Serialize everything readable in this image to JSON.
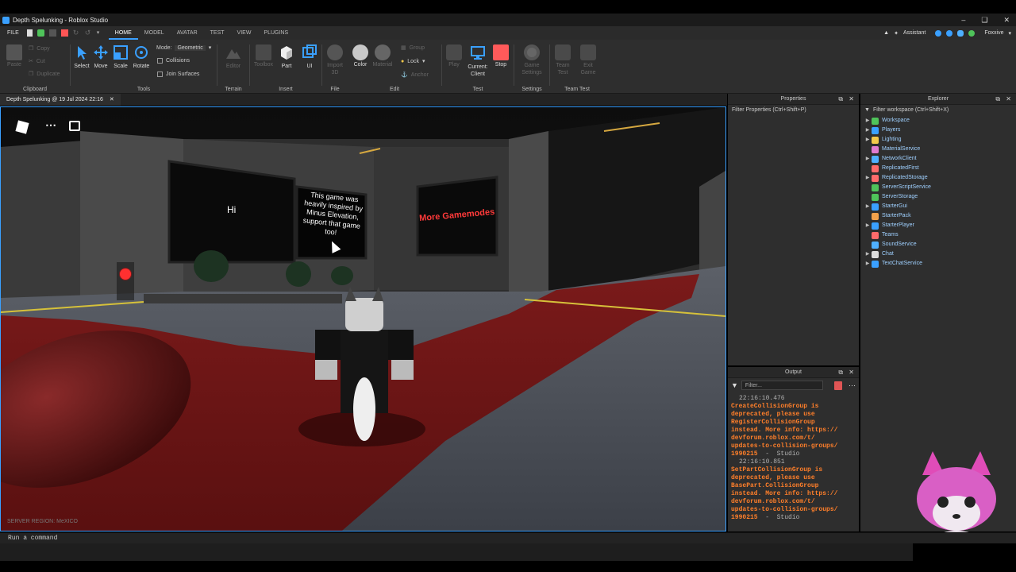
{
  "window": {
    "title": "Depth Spelunking - Roblox Studio"
  },
  "menu": {
    "file": "FILE",
    "tabs": [
      "HOME",
      "MODEL",
      "AVATAR",
      "TEST",
      "VIEW",
      "PLUGINS"
    ],
    "assistant": "Assistant",
    "user": "Foxxive"
  },
  "ribbon": {
    "clipboard": {
      "label": "Clipboard",
      "paste": "Paste",
      "copy": "Copy",
      "cut": "Cut",
      "duplicate": "Duplicate"
    },
    "tools": {
      "label": "Tools",
      "select": "Select",
      "move": "Move",
      "scale": "Scale",
      "rotate": "Rotate",
      "mode_label": "Mode:",
      "mode_value": "Geometric",
      "collisions": "Collisions",
      "join_surfaces": "Join Surfaces"
    },
    "terrain": {
      "label": "Terrain",
      "editor": "Editor"
    },
    "insert": {
      "label": "Insert",
      "toolbox": "Toolbox",
      "part": "Part",
      "ui": "UI"
    },
    "file": {
      "label": "File",
      "import3d": "Import 3D"
    },
    "edit": {
      "label": "Edit",
      "color": "Color",
      "material": "Material",
      "group": "Group",
      "lock": "Lock",
      "anchor": "Anchor"
    },
    "test": {
      "label": "Test",
      "play": "Play",
      "current_client": "Current: Client",
      "stop": "Stop"
    },
    "settings": {
      "label": "Settings",
      "game_settings": "Game Settings"
    },
    "team_test": {
      "label": "Team Test",
      "team_test": "Team Test",
      "exit_game": "Exit Game"
    }
  },
  "doc_tab": {
    "label": "Depth Spelunking @ 19 Jul 2024 22:16"
  },
  "viewport": {
    "sign_hi": "Hi",
    "sign_inspired_lines": [
      "This game was",
      "heavily inspired by",
      "Minus Elevation,",
      "support that game",
      "too!"
    ],
    "sign_gamemodes": "More Gamemodes",
    "server_region": "SERVER REGION: MeXICO"
  },
  "properties": {
    "title": "Properties",
    "filter_placeholder": "Filter Properties (Ctrl+Shift+P)"
  },
  "explorer": {
    "title": "Explorer",
    "filter_placeholder": "Filter workspace (Ctrl+Shift+X)",
    "items": [
      {
        "label": "Workspace",
        "expandable": true,
        "color": "#4fc35a"
      },
      {
        "label": "Players",
        "expandable": true,
        "color": "#3aa0ff"
      },
      {
        "label": "Lighting",
        "expandable": true,
        "color": "#f2c84b"
      },
      {
        "label": "MaterialService",
        "expandable": false,
        "color": "#e07bd0"
      },
      {
        "label": "NetworkClient",
        "expandable": true,
        "color": "#4fb0ff"
      },
      {
        "label": "ReplicatedFirst",
        "expandable": false,
        "color": "#ff6b6b"
      },
      {
        "label": "ReplicatedStorage",
        "expandable": true,
        "color": "#ff6b6b"
      },
      {
        "label": "ServerScriptService",
        "expandable": false,
        "color": "#4fc35a"
      },
      {
        "label": "ServerStorage",
        "expandable": false,
        "color": "#4fc35a"
      },
      {
        "label": "StarterGui",
        "expandable": true,
        "color": "#3aa0ff"
      },
      {
        "label": "StarterPack",
        "expandable": false,
        "color": "#f2a14b"
      },
      {
        "label": "StarterPlayer",
        "expandable": true,
        "color": "#3aa0ff"
      },
      {
        "label": "Teams",
        "expandable": false,
        "color": "#ff6b6b"
      },
      {
        "label": "SoundService",
        "expandable": false,
        "color": "#4fb0ff"
      },
      {
        "label": "Chat",
        "expandable": true,
        "color": "#dddddd"
      },
      {
        "label": "TextChatService",
        "expandable": true,
        "color": "#3aa0ff"
      }
    ]
  },
  "output": {
    "title": "Output",
    "filter_placeholder": "Filter...",
    "lines": [
      {
        "type": "time",
        "text": "22:16:10.476"
      },
      {
        "type": "warn",
        "text": "CreateCollisionGroup is deprecated, please use RegisterCollisionGroup instead. More info: https://devforum.roblox.com/t/updates-to-collision-groups/1990215"
      },
      {
        "type": "time",
        "text": "22:16:10.851"
      },
      {
        "type": "warn",
        "text": "SetPartCollisionGroup is deprecated, please use BasePart.CollisionGroup instead. More info: https://devforum.roblox.com/t/updates-to-collision-groups/1990215"
      }
    ],
    "warn_lines_1": [
      "CreateCollisionGroup is",
      "deprecated, please use",
      "RegisterCollisionGroup",
      "instead. More info: https://",
      "devforum.roblox.com/t/",
      "updates-to-collision-groups/",
      "1990215"
    ],
    "warn_lines_2": [
      "SetPartCollisionGroup is",
      "deprecated, please use",
      "BasePart.CollisionGroup",
      "instead. More info: https://",
      "devforum.roblox.com/t/",
      "updates-to-collision-groups/",
      "1990215"
    ],
    "source": "Studio"
  },
  "command_bar": {
    "placeholder": "Run a command"
  }
}
